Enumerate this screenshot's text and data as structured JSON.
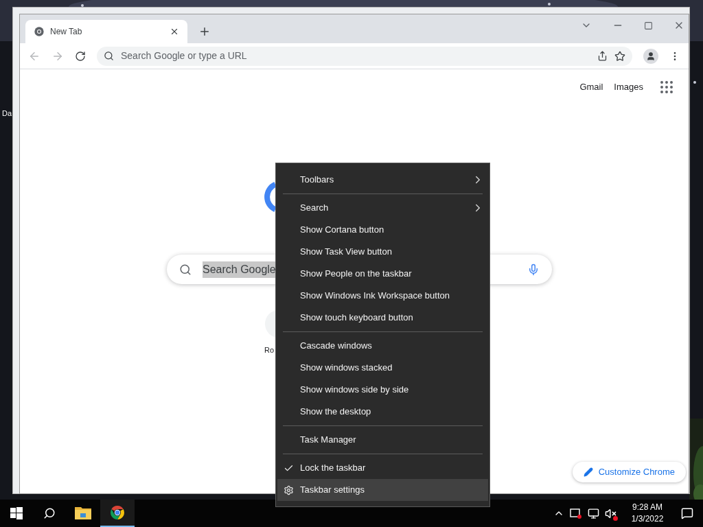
{
  "desktop": {
    "icon_labels": [
      "Da"
    ]
  },
  "browser": {
    "tab": {
      "title": "New Tab",
      "selected": true
    },
    "omnibox": {
      "placeholder": "Search Google or type a URL"
    },
    "header_links": [
      "Gmail",
      "Images"
    ],
    "search": {
      "value": "Search Google"
    },
    "shortcut": {
      "label": "Ro"
    },
    "customize_button": "Customize Chrome"
  },
  "context_menu": {
    "groups": [
      {
        "items": [
          {
            "label": "Toolbars",
            "kind": "submenu",
            "checked": false,
            "selected": false
          }
        ]
      },
      {
        "items": [
          {
            "label": "Search",
            "kind": "submenu",
            "checked": false,
            "selected": false
          },
          {
            "label": "Show Cortana button",
            "kind": "command",
            "checked": false,
            "selected": false
          },
          {
            "label": "Show Task View button",
            "kind": "command",
            "checked": false,
            "selected": false
          },
          {
            "label": "Show People on the taskbar",
            "kind": "command",
            "checked": false,
            "selected": false
          },
          {
            "label": "Show Windows Ink Workspace button",
            "kind": "command",
            "checked": false,
            "selected": false
          },
          {
            "label": "Show touch keyboard button",
            "kind": "command",
            "checked": false,
            "selected": false
          }
        ]
      },
      {
        "items": [
          {
            "label": "Cascade windows",
            "kind": "command",
            "checked": false,
            "selected": false
          },
          {
            "label": "Show windows stacked",
            "kind": "command",
            "checked": false,
            "selected": false
          },
          {
            "label": "Show windows side by side",
            "kind": "command",
            "checked": false,
            "selected": false
          },
          {
            "label": "Show the desktop",
            "kind": "command",
            "checked": false,
            "selected": false
          }
        ]
      },
      {
        "items": [
          {
            "label": "Task Manager",
            "kind": "command",
            "checked": false,
            "selected": false
          }
        ]
      },
      {
        "items": [
          {
            "label": "Lock the taskbar",
            "kind": "command",
            "checked": true,
            "selected": false
          },
          {
            "label": "Taskbar settings",
            "kind": "settings",
            "checked": false,
            "selected": true
          }
        ]
      }
    ]
  },
  "taskbar": {
    "apps": [
      {
        "kind": "explorer",
        "active": false
      },
      {
        "kind": "chrome",
        "active": true
      }
    ],
    "clock": {
      "time": "9:28 AM",
      "date": "1/3/2022"
    }
  }
}
